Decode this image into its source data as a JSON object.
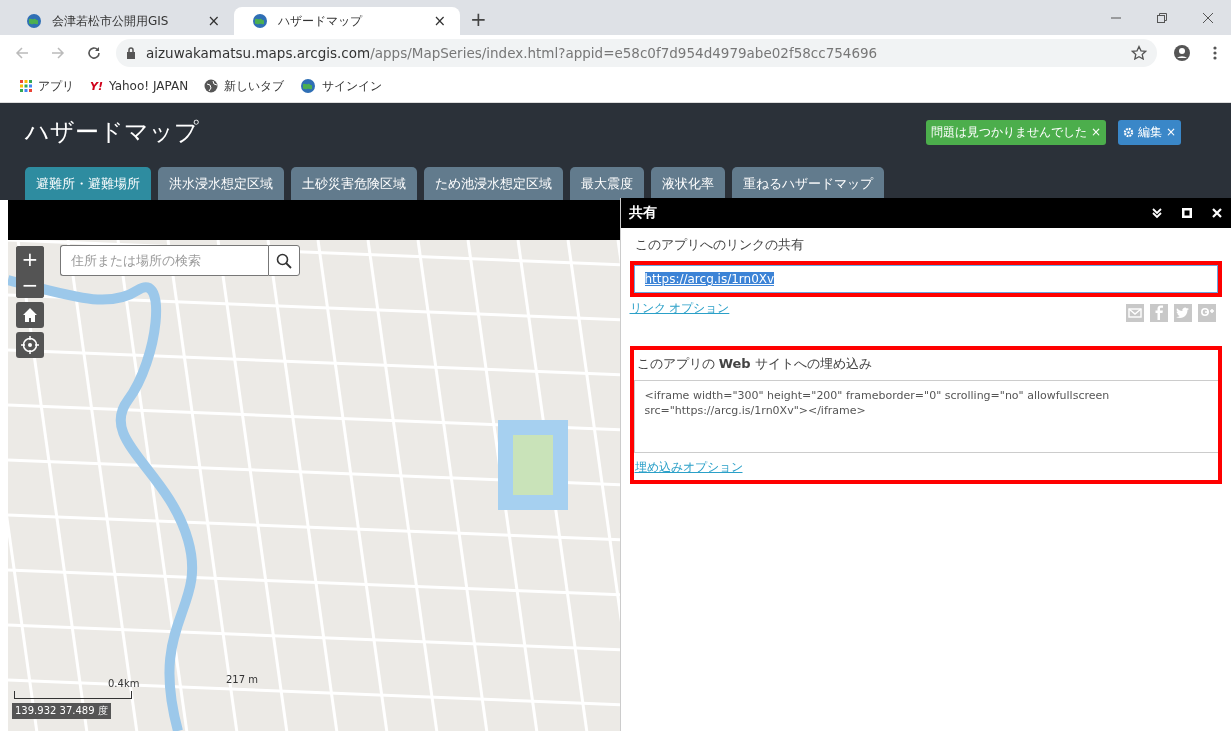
{
  "browser": {
    "tabs": [
      {
        "title": "会津若松市公開用GIS",
        "close": "×",
        "selected": false
      },
      {
        "title": "ハザードマップ",
        "close": "×",
        "selected": true
      }
    ],
    "new_tab": "+",
    "url_host": "aizuwakamatsu.maps.arcgis.com",
    "url_path": "/apps/MapSeries/index.html?appid=e58c0f7d954d4979abe02f58cc754696",
    "bookmarks": [
      {
        "kind": "apps",
        "label": "アプリ"
      },
      {
        "kind": "yahoo",
        "logo": "Y!",
        "label": "Yahoo! JAPAN"
      },
      {
        "kind": "globe",
        "label": "新しいタブ"
      },
      {
        "kind": "earth",
        "label": "サインイン"
      }
    ]
  },
  "app": {
    "title": "ハザードマップ",
    "badges": [
      {
        "kind": "status",
        "text": "問題は見つかりませんでした",
        "close": "×",
        "color": "#4cae4c"
      },
      {
        "kind": "edit",
        "text": "編集",
        "close": "×",
        "color": "#3a87c8"
      }
    ],
    "tabs": [
      {
        "label": "避難所・避難場所",
        "selected": true
      },
      {
        "label": "洪水浸水想定区域",
        "selected": false
      },
      {
        "label": "土砂災害危険区域",
        "selected": false
      },
      {
        "label": "ため池浸水想定区域",
        "selected": false
      },
      {
        "label": "最大震度",
        "selected": false
      },
      {
        "label": "液状化率",
        "selected": false
      },
      {
        "label": "重ねるハザードマップ",
        "selected": false
      }
    ]
  },
  "map": {
    "zoom_in": "+",
    "zoom_out": "−",
    "search": {
      "placeholder": "住所または場所の検索"
    },
    "scale_km": "0.4km",
    "scale_m": "217 m",
    "coordinates": "139.932 37.489 度"
  },
  "share": {
    "title": "共有",
    "link_label": "このアプリへのリンクの共有",
    "link_value": "https://arcg.is/1rn0Xv",
    "link_options": "リンク オプション",
    "embed_label": "このアプリの **Web** サイトへの埋め込み",
    "embed_code": "<iframe width=\"300\" height=\"200\" frameborder=\"0\" scrolling=\"no\" allowfullscreen src=\"https://arcg.is/1rn0Xv\"></iframe>",
    "embed_options": "埋め込みオプション"
  }
}
